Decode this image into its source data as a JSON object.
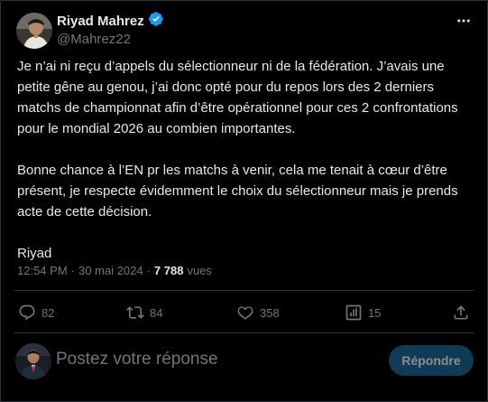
{
  "author": {
    "display_name": "Riyad Mahrez",
    "handle": "@Mahrez22",
    "verified": true
  },
  "tweet": {
    "paragraph1": "Je n’ai ni reçu d’appels du sélectionneur ni de la fédération. J’avais une petite gêne au genou, j’ai donc opté pour du repos lors des 2 derniers matchs de championnat afin d’être opérationnel pour ces 2 confrontations pour le mondial 2026 au combien importantes.",
    "paragraph2": "Bonne chance à l’EN pr les matchs à venir, cela me tenait à cœur d’être présent, je respecte évidemment le choix du sélectionneur mais je prends acte de cette décision.",
    "paragraph3": "Riyad"
  },
  "meta": {
    "time": "12:54 PM",
    "separator": "·",
    "date": "30 mai 2024",
    "views_count": "7 788",
    "views_label": "vues"
  },
  "actions": {
    "replies": "82",
    "retweets": "84",
    "likes": "358",
    "bookmarks": "15"
  },
  "reply_box": {
    "placeholder": "Postez votre réponse",
    "button_label": "Répondre"
  },
  "icons": {
    "verified": "verified-badge-icon",
    "more": "more-horizontal-icon",
    "reply": "reply-icon",
    "retweet": "retweet-icon",
    "like": "heart-icon",
    "bookmark": "bookmark-icon",
    "share": "share-icon"
  },
  "colors": {
    "background": "#000000",
    "text_primary": "#e7e9ea",
    "text_secondary": "#71767b",
    "divider": "#2f3336",
    "verified": "#1d9bf0",
    "button": "#1d6c9f"
  }
}
